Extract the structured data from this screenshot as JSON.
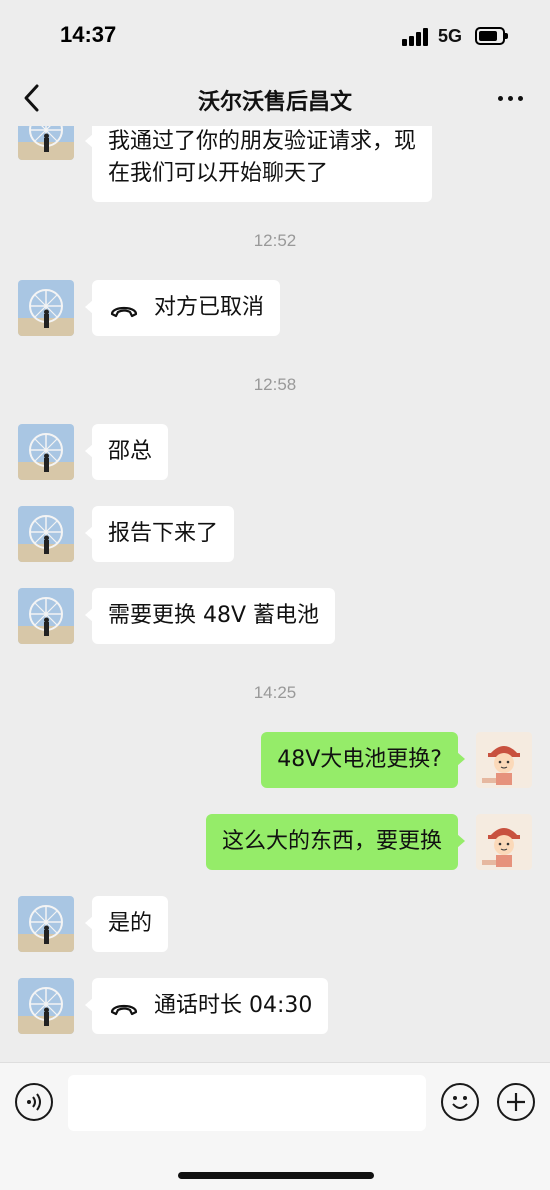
{
  "status_bar": {
    "time": "14:37",
    "network": "5G"
  },
  "header": {
    "title": "沃尔沃售后昌文"
  },
  "messages": [
    {
      "type": "text",
      "side": "in",
      "lines": [
        "我通过了你的朋友验证请求，现",
        "在我们可以开始聊天了"
      ]
    },
    {
      "type": "time",
      "text": "12:52"
    },
    {
      "type": "call",
      "side": "in",
      "text": "对方已取消"
    },
    {
      "type": "time",
      "text": "12:58"
    },
    {
      "type": "text",
      "side": "in",
      "text": "邵总"
    },
    {
      "type": "text",
      "side": "in",
      "text": "报告下来了"
    },
    {
      "type": "text",
      "side": "in",
      "text": "需要更换 48V 蓄电池"
    },
    {
      "type": "time",
      "text": "14:25"
    },
    {
      "type": "text",
      "side": "out",
      "text": "48V大电池更换?"
    },
    {
      "type": "text",
      "side": "out",
      "text": "这么大的东西，要更换"
    },
    {
      "type": "text",
      "side": "in",
      "text": "是的"
    },
    {
      "type": "call",
      "side": "in",
      "text": "通话时长 04:30"
    }
  ],
  "input": {
    "value": ""
  },
  "colors": {
    "background": "#ededed",
    "incoming_bubble": "#ffffff",
    "outgoing_bubble": "#95ec69",
    "timestamp": "#999999"
  },
  "icons": [
    "back-icon",
    "more-icon",
    "voice-icon",
    "emoji-icon",
    "plus-icon",
    "phone-icon"
  ]
}
